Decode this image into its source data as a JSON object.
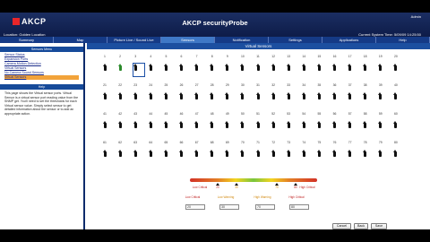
{
  "header": {
    "logo": "AKCP",
    "title": "AKCP securityProbe",
    "admin_link": "Admin",
    "location": "Location: Golden Location",
    "system_time": "Current System Time: 5/09/09 14:25:50"
  },
  "tabs": [
    {
      "label": "Summary"
    },
    {
      "label": "Map"
    },
    {
      "label": "Picture Live / Sound Live"
    },
    {
      "label": "Sensors"
    },
    {
      "label": "Notification"
    },
    {
      "label": "Settings"
    },
    {
      "label": "Applications"
    },
    {
      "label": "Help"
    }
  ],
  "sidebar": {
    "links_header": "Sensors Menu",
    "links": [
      {
        "label": "Sensor Status"
      },
      {
        "label": "Expansion Ports"
      },
      {
        "label": "Camera Motion Detection"
      },
      {
        "label": "Virtual Sensors"
      },
      {
        "label": "No Camera Sound Sensors"
      },
      {
        "label": "Virtual Sensors"
      }
    ],
    "help_header": "Help",
    "help_text": "This page shows the Virtual sensor ports. Virtual Sensor is a virtual sensor port reading value from the SNMP get. You'll need to set the thresholds for each Virtual sensor value. Simply select sensor to get detailed information about the sensor or to add an appropriate action."
  },
  "main": {
    "title": "Virtual Sensors",
    "sensor_numbers": [
      "1",
      "2",
      "3",
      "4",
      "5",
      "6",
      "7",
      "8",
      "9",
      "10",
      "11",
      "12",
      "13",
      "14",
      "15",
      "16",
      "17",
      "18",
      "19",
      "20",
      "21",
      "22",
      "23",
      "24",
      "25",
      "26",
      "27",
      "28",
      "29",
      "30",
      "31",
      "32",
      "33",
      "34",
      "35",
      "36",
      "37",
      "38",
      "39",
      "40",
      "41",
      "42",
      "43",
      "44",
      "45",
      "46",
      "47",
      "48",
      "49",
      "50",
      "51",
      "52",
      "53",
      "54",
      "55",
      "56",
      "57",
      "58",
      "59",
      "60",
      "61",
      "62",
      "63",
      "64",
      "65",
      "66",
      "67",
      "68",
      "69",
      "70",
      "71",
      "72",
      "73",
      "74",
      "75",
      "76",
      "77",
      "78",
      "79",
      "80"
    ]
  },
  "threshold": {
    "low_critical_tag": "Low Critical",
    "ticks": [
      "20",
      "30",
      "70",
      "80"
    ],
    "high_critical_tag": "High Critical",
    "labels": [
      {
        "text": "Low Critical",
        "color": "#c02525"
      },
      {
        "text": "Low Warning",
        "color": "#d28a12"
      },
      {
        "text": "High Warning",
        "color": "#d28a12"
      },
      {
        "text": "High Critical",
        "color": "#c02525"
      }
    ],
    "values": [
      "20",
      "30",
      "70",
      "80"
    ]
  },
  "buttons": {
    "cancel": "Cancel",
    "back": "Back",
    "save": "Save"
  }
}
